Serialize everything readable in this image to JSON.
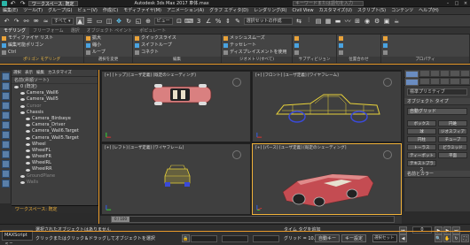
{
  "titlebar": {
    "workspace": "ワークスペース: 既定",
    "title": "Autodesk 3ds Max 2017   車体.max",
    "search_placeholder": "キーワードまたは語句を入力"
  },
  "menubar": {
    "items": [
      "編集(E)",
      "ツール(T)",
      "グループ(G)",
      "ビュー(V)",
      "作成(C)",
      "モディファイヤ(M)",
      "アニメーション(A)",
      "グラフ エディタ(D)",
      "レンダリング(R)",
      "Civil View",
      "カスタマイズ(U)",
      "スクリプト(S)",
      "コンテンツ",
      "ヘルプ(H)"
    ]
  },
  "toolbar": {
    "view_dropdown": "ビュー",
    "selection_set": "選択セットの作成"
  },
  "ribbon": {
    "tabs": [
      "モデリング",
      "フリーフォーム",
      "選択",
      "オブジェクト ペイント",
      "ポピュレート"
    ],
    "active_tab": 0,
    "groups": [
      {
        "footer": "ポリゴン モデリング",
        "items": [
          "モディファイヤ リスト",
          "編集可能ポリゴン",
          "Ctrl"
        ]
      },
      {
        "footer": "選択を変更",
        "items": [
          "拡大",
          "縮小",
          "ループ"
        ]
      },
      {
        "footer": "編集",
        "items": [
          "クイックスライス",
          "スイフトループ",
          "コネクト"
        ]
      },
      {
        "footer": "ジオメトリ(すべて)",
        "items": [
          "メッシュスムーズ",
          "テッセレート",
          "ディスプレイスメントを使用"
        ]
      },
      {
        "footer": "サブディビジョン",
        "items": [
          "",
          "",
          ""
        ]
      },
      {
        "footer": "位置合わせ",
        "items": [
          "",
          "",
          ""
        ]
      },
      {
        "footer": "プロパティ",
        "items": [
          "",
          "",
          ""
        ]
      }
    ]
  },
  "scene_explorer": {
    "tabs": [
      "選択",
      "表示",
      "編集",
      "カスタマイズ"
    ],
    "header": "名前(昇順ソート)",
    "items": [
      {
        "label": "0 (既定)",
        "indent": 0,
        "dim": false
      },
      {
        "label": "Camera_Wall6",
        "indent": 1,
        "dim": false
      },
      {
        "label": "Camera_Wall5",
        "indent": 1,
        "dim": false
      },
      {
        "label": "Cursor",
        "indent": 1,
        "dim": true
      },
      {
        "label": "Chassis",
        "indent": 1,
        "dim": false
      },
      {
        "label": "Camera_Birdseye",
        "indent": 2,
        "dim": false
      },
      {
        "label": "Camera_Driver",
        "indent": 2,
        "dim": false
      },
      {
        "label": "Camera_Wall6.Target",
        "indent": 2,
        "dim": false
      },
      {
        "label": "Camera_Wall5.Target",
        "indent": 2,
        "dim": false
      },
      {
        "label": "Wheel",
        "indent": 2,
        "dim": false
      },
      {
        "label": "WheelFL",
        "indent": 2,
        "dim": false
      },
      {
        "label": "WheelFR",
        "indent": 2,
        "dim": false
      },
      {
        "label": "WheelRL",
        "indent": 2,
        "dim": false
      },
      {
        "label": "WheelRR",
        "indent": 2,
        "dim": false
      },
      {
        "label": "GroundPlane",
        "indent": 1,
        "dim": true
      },
      {
        "label": "Walls",
        "indent": 1,
        "dim": true
      }
    ],
    "workspace_switch": "ワークスペース: 既定"
  },
  "viewports": [
    {
      "label": "[+] [トップ] [ユーザ定義] [既定のシェーディング]"
    },
    {
      "label": "[+] [フロント] [ユーザ定義] [ワイヤフレーム]"
    },
    {
      "label": "[+] [レフト] [ユーザ定義] [ワイヤフレーム]"
    },
    {
      "label": "[+] [パース] [ユーザ定義] [既定のシェーディング]"
    }
  ],
  "command_panel": {
    "type_dropdown": "標準プリミティブ",
    "section_object_type": "オブジェクト タイプ",
    "auto_grid": "自動グリッド",
    "buttons": [
      "ボックス",
      "円錐",
      "球",
      "ジオスフィア",
      "円柱",
      "チューブ",
      "トーラス",
      "ピラミッド",
      "ティーポット",
      "平面",
      "テキストプラス"
    ],
    "section_name_color": "名前とカラー"
  },
  "status": {
    "maxscript": "MAXScript ミニ",
    "msg1": "選択されたオブジェクトはありません",
    "msg2": "クリックまたはクリック＆ドラッグしてオブジェクトを選択",
    "add_time_tag": "タイム タグを追加",
    "grid": "グリッド = 10.0",
    "auto_key": "自動キー",
    "set_key": "キー設定",
    "selection_filter": "選択セット",
    "frame": "0",
    "time_slider": "0 / 100"
  },
  "colors": {
    "accent_orange": "#e99a2a",
    "active_border": "#f2b33a",
    "car_red": "#d85a5a",
    "wire_yellow": "#e8d23a",
    "wire_blue": "#3a4ad8"
  }
}
